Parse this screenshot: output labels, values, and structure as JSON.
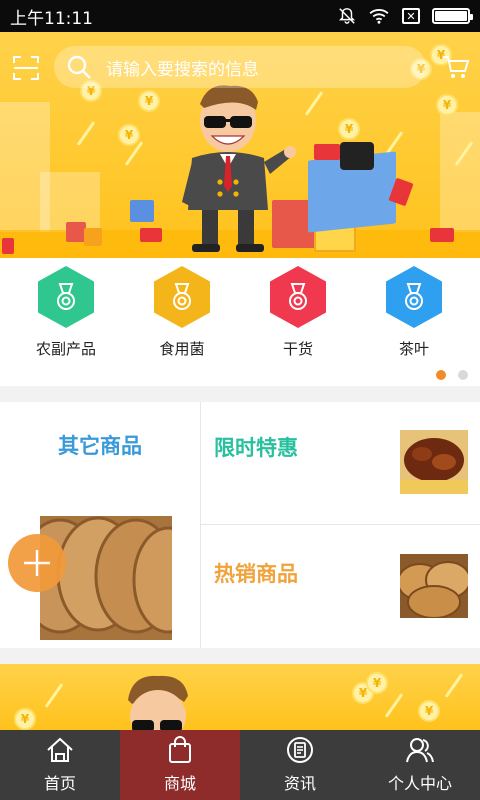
{
  "status_bar": {
    "time": "上午11:11"
  },
  "search": {
    "placeholder": "请输入要搜索的信息"
  },
  "categories": [
    {
      "label": "农副产品",
      "color": "#2fc78f"
    },
    {
      "label": "食用菌",
      "color": "#f3b51a"
    },
    {
      "label": "干货",
      "color": "#f0384f"
    },
    {
      "label": "茶叶",
      "color": "#2f9ff0"
    }
  ],
  "promo": {
    "other": "其它商品",
    "limited": "限时特惠",
    "hot": "热销商品"
  },
  "tabs": [
    {
      "label": "首页",
      "icon": "home-icon"
    },
    {
      "label": "商城",
      "icon": "shopping-bag-icon"
    },
    {
      "label": "资讯",
      "icon": "news-icon"
    },
    {
      "label": "个人中心",
      "icon": "profile-icon"
    }
  ],
  "colors": {
    "accent_orange": "#f08c2a",
    "tab_active": "#8e2b2b",
    "tabbar_bg": "#3c3c3c",
    "banner": "#ffc21c"
  }
}
